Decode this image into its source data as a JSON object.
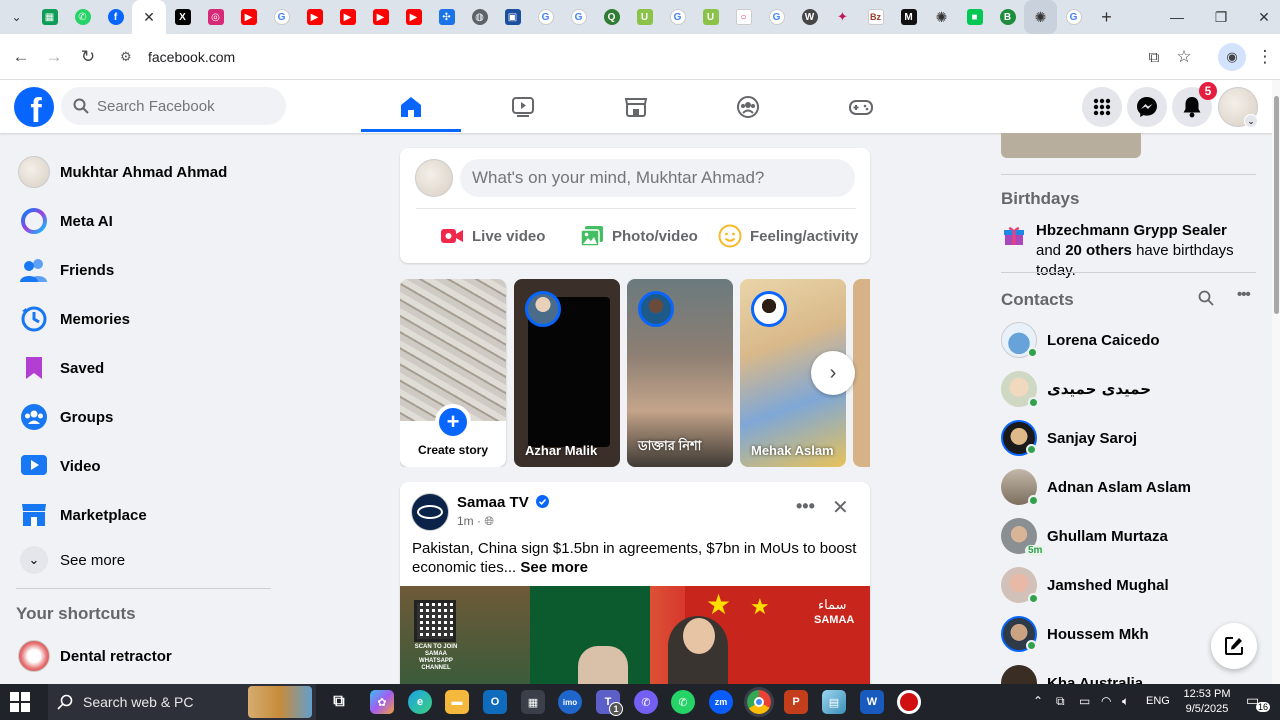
{
  "browser": {
    "tabs": [
      {
        "icon": "chevron-down-icon",
        "color": "#dde3ea"
      },
      {
        "icon": "sheets-icon",
        "color": "#0f9d58"
      },
      {
        "icon": "whatsapp-icon",
        "color": "#25d366"
      },
      {
        "icon": "facebook-icon",
        "color": "#0866ff"
      },
      {
        "icon": "x-icon",
        "color": "#000000"
      },
      {
        "icon": "instagram-icon",
        "color": "#d62976"
      },
      {
        "icon": "youtube-icon",
        "color": "#ff0000"
      },
      {
        "icon": "google-icon",
        "color": "#4285f4"
      },
      {
        "icon": "youtube-icon",
        "color": "#ff0000"
      },
      {
        "icon": "youtube-icon",
        "color": "#ff0000"
      },
      {
        "icon": "youtube-icon",
        "color": "#ff0000"
      },
      {
        "icon": "youtube-icon",
        "color": "#ff0000"
      },
      {
        "icon": "puzzle-icon",
        "color": "#1a73e8"
      },
      {
        "icon": "globe-icon",
        "color": "#5f6368"
      },
      {
        "icon": "map-icon",
        "color": "#1a4fa0"
      },
      {
        "icon": "google-icon",
        "color": "#4285f4"
      },
      {
        "icon": "google-icon",
        "color": "#4285f4"
      },
      {
        "icon": "quora-icon",
        "color": "#2e7d32"
      },
      {
        "icon": "u-icon",
        "color": "#8bc34a"
      },
      {
        "icon": "google-icon",
        "color": "#4285f4"
      },
      {
        "icon": "u-icon",
        "color": "#8bc34a"
      },
      {
        "icon": "circle-icon",
        "color": "#e91e63"
      },
      {
        "icon": "google-icon",
        "color": "#4285f4"
      },
      {
        "icon": "wordpress-icon",
        "color": "#464646"
      },
      {
        "icon": "star-icon",
        "color": "#c2185b"
      },
      {
        "icon": "bz-icon",
        "color": "#9e3a2a"
      },
      {
        "icon": "m-icon",
        "color": "#111111"
      },
      {
        "icon": "chatgpt-icon",
        "color": "#333333"
      },
      {
        "icon": "chat-icon",
        "color": "#00c853"
      },
      {
        "icon": "b-icon",
        "color": "#1e8e3e"
      },
      {
        "icon": "chatgpt-icon",
        "color": "#333333"
      },
      {
        "icon": "google-icon",
        "color": "#4285f4"
      }
    ],
    "active_tab_close": "✕",
    "new_tab": "+",
    "url": "facebook.com"
  },
  "fb": {
    "search_placeholder": "Search Facebook",
    "notif_count": "5",
    "brand_color": "#0866ff",
    "logo": "f"
  },
  "left": {
    "profile_name": "Mukhtar Ahmad Ahmad",
    "items": [
      {
        "label": "Meta AI"
      },
      {
        "label": "Friends"
      },
      {
        "label": "Memories"
      },
      {
        "label": "Saved"
      },
      {
        "label": "Groups"
      },
      {
        "label": "Video"
      },
      {
        "label": "Marketplace"
      },
      {
        "label": "See more"
      }
    ],
    "shortcuts_title": "Your shortcuts",
    "shortcut_1": "Dental retractor"
  },
  "composer": {
    "placeholder": "What's on your mind, Mukhtar Ahmad?",
    "live_video": "Live video",
    "photo_video": "Photo/video",
    "feeling": "Feeling/activity"
  },
  "stories": {
    "create": "Create story",
    "items": [
      {
        "name": "Azhar Malik"
      },
      {
        "name": "ডাক্তার নিশা"
      },
      {
        "name": "Mehak Aslam"
      }
    ]
  },
  "post": {
    "author": "Samaa TV",
    "time": "1m · ",
    "text": "Pakistan, China sign $1.5bn in agreements, $7bn in MoUs to boost economic ties...",
    "see_more": "See more",
    "image_brand": "SAMAA",
    "image_brand_urdu": "سماء",
    "qr_caption": "SCAN TO JOIN SAMAA WHATSAPP CHANNEL"
  },
  "right": {
    "birthdays_title": "Birthdays",
    "bday_name": "Hbzechmann Grypp Sealer",
    "bday_and": " and ",
    "bday_others": "20 others",
    "bday_suffix": " have birthdays today.",
    "contacts_title": "Contacts",
    "contacts": [
      {
        "name": "Lorena Caicedo",
        "online": true
      },
      {
        "name": "حمیدی حمیدی",
        "online": true
      },
      {
        "name": "Sanjay Saroj",
        "online": true
      },
      {
        "name": "Adnan Aslam Aslam",
        "online": true
      },
      {
        "name": "Ghullam Murtaza",
        "online": false,
        "ago": "5m"
      },
      {
        "name": "Jamshed Mughal",
        "online": true
      },
      {
        "name": "Houssem Mkh",
        "online": true
      },
      {
        "name": "Kha Australia",
        "online": false
      }
    ]
  },
  "taskbar": {
    "search": "Search web & PC",
    "lang": "ENG",
    "time": "12:53 PM",
    "date": "9/5/2025",
    "notif_count": "16",
    "teams_badge": "1"
  }
}
